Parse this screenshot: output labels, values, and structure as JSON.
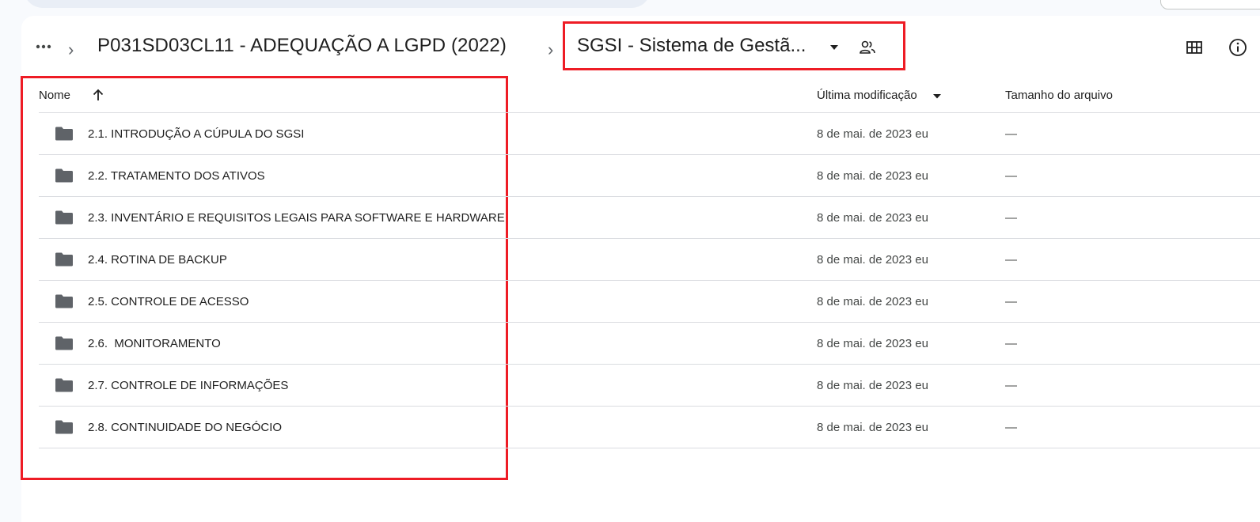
{
  "breadcrumb": {
    "more_label": "...",
    "parent": "P031SD03CL11 - ADEQUAÇÃO A LGPD (2022)",
    "current": "SGSI - Sistema de Gestã..."
  },
  "table": {
    "headers": {
      "name": "Nome",
      "modified": "Última modificação",
      "size": "Tamanho do arquivo"
    },
    "rows": [
      {
        "name": "2.1. INTRODUÇÃO A CÚPULA DO SGSI",
        "modified": "8 de mai. de 2023 eu",
        "size": "—"
      },
      {
        "name": "2.2. TRATAMENTO DOS ATIVOS",
        "modified": "8 de mai. de 2023 eu",
        "size": "—"
      },
      {
        "name": "2.3. INVENTÁRIO E REQUISITOS LEGAIS PARA SOFTWARE E HARDWARE",
        "modified": "8 de mai. de 2023 eu",
        "size": "—"
      },
      {
        "name": "2.4. ROTINA DE BACKUP",
        "modified": "8 de mai. de 2023 eu",
        "size": "—"
      },
      {
        "name": "2.5. CONTROLE DE ACESSO",
        "modified": "8 de mai. de 2023 eu",
        "size": "—"
      },
      {
        "name": "2.6.  MONITORAMENTO",
        "modified": "8 de mai. de 2023 eu",
        "size": "—"
      },
      {
        "name": "2.7. CONTROLE DE INFORMAÇÕES",
        "modified": "8 de mai. de 2023 eu",
        "size": "—"
      },
      {
        "name": "2.8. CONTINUIDADE DO NEGÓCIO",
        "modified": "8 de mai. de 2023 eu",
        "size": "—"
      }
    ]
  },
  "icons": {
    "more": "more-horiz-icon",
    "separator": "chevron-right-icon",
    "dropdown": "arrow-drop-down-icon",
    "shared": "shared-people-icon",
    "grid": "grid-view-icon",
    "info": "info-icon",
    "sort": "arrow-upward-icon",
    "folder": "folder-icon"
  },
  "colors": {
    "highlight": "#ee1c25",
    "folder": "#5f6368",
    "background": "#f8fafd",
    "panel": "#ffffff"
  }
}
